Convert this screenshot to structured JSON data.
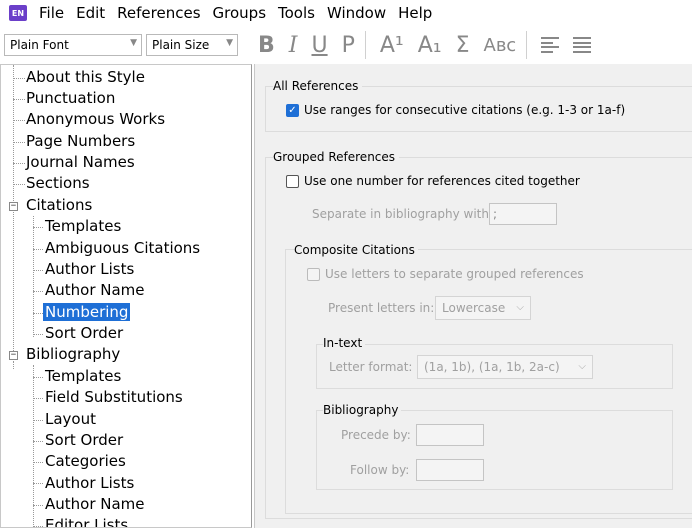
{
  "menubar": {
    "app_icon": "EN",
    "items": [
      "File",
      "Edit",
      "References",
      "Groups",
      "Tools",
      "Window",
      "Help"
    ]
  },
  "toolbar": {
    "font_value": "Plain Font",
    "size_value": "Plain Size",
    "buttons": [
      "B",
      "I",
      "U",
      "P",
      "A¹",
      "A₁",
      "Σ",
      "Aʙᴄ"
    ],
    "align_icons": [
      "align-left-icon",
      "align-justify-icon"
    ]
  },
  "tree": {
    "items": [
      {
        "label": "About this Style",
        "level": 0
      },
      {
        "label": "Punctuation",
        "level": 0
      },
      {
        "label": "Anonymous Works",
        "level": 0
      },
      {
        "label": "Page Numbers",
        "level": 0
      },
      {
        "label": "Journal Names",
        "level": 0
      },
      {
        "label": "Sections",
        "level": 0
      },
      {
        "label": "Citations",
        "level": 0,
        "expanded": true
      },
      {
        "label": "Templates",
        "level": 1
      },
      {
        "label": "Ambiguous Citations",
        "level": 1
      },
      {
        "label": "Author Lists",
        "level": 1
      },
      {
        "label": "Author Name",
        "level": 1
      },
      {
        "label": "Numbering",
        "level": 1,
        "selected": true
      },
      {
        "label": "Sort Order",
        "level": 1
      },
      {
        "label": "Bibliography",
        "level": 0,
        "expanded": true
      },
      {
        "label": "Templates",
        "level": 1
      },
      {
        "label": "Field Substitutions",
        "level": 1
      },
      {
        "label": "Layout",
        "level": 1
      },
      {
        "label": "Sort Order",
        "level": 1
      },
      {
        "label": "Categories",
        "level": 1
      },
      {
        "label": "Author Lists",
        "level": 1
      },
      {
        "label": "Author Name",
        "level": 1
      },
      {
        "label": "Editor Lists",
        "level": 1
      }
    ]
  },
  "panel": {
    "all_refs": {
      "title": "All References",
      "ranges_label": "Use ranges for consecutive citations (e.g. 1-3 or 1a-f)",
      "ranges_checked": true
    },
    "grouped": {
      "title": "Grouped References",
      "one_number_label": "Use one number for references cited together",
      "one_number_checked": false,
      "separate_label": "Separate in bibliography with:",
      "separate_value": ";"
    },
    "composite": {
      "title": "Composite Citations",
      "letters_label": "Use letters to separate grouped references",
      "present_label": "Present letters in:",
      "present_value": "Lowercase",
      "intext_title": "In-text",
      "letter_format_label": "Letter format:",
      "letter_format_value": "(1a, 1b), (1a, 1b, 2a-c)",
      "bib_title": "Bibliography",
      "precede_label": "Precede by:",
      "precede_value": "",
      "follow_label": "Follow by:",
      "follow_value": ""
    }
  }
}
